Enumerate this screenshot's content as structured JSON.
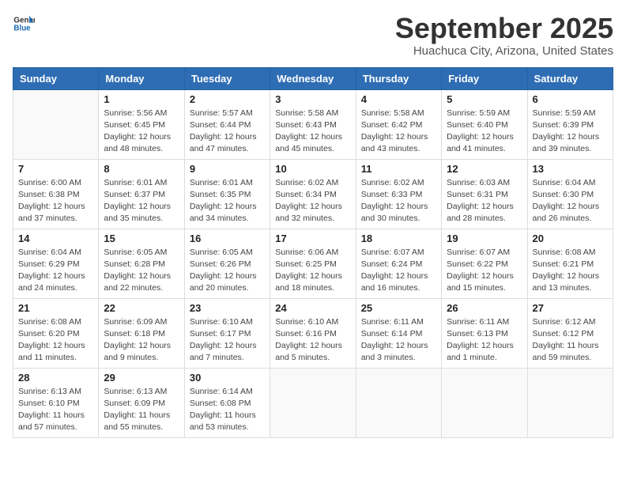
{
  "logo": {
    "line1": "General",
    "line2": "Blue"
  },
  "title": "September 2025",
  "location": "Huachuca City, Arizona, United States",
  "days_of_week": [
    "Sunday",
    "Monday",
    "Tuesday",
    "Wednesday",
    "Thursday",
    "Friday",
    "Saturday"
  ],
  "weeks": [
    [
      {
        "day": "",
        "info": ""
      },
      {
        "day": "1",
        "info": "Sunrise: 5:56 AM\nSunset: 6:45 PM\nDaylight: 12 hours\nand 48 minutes."
      },
      {
        "day": "2",
        "info": "Sunrise: 5:57 AM\nSunset: 6:44 PM\nDaylight: 12 hours\nand 47 minutes."
      },
      {
        "day": "3",
        "info": "Sunrise: 5:58 AM\nSunset: 6:43 PM\nDaylight: 12 hours\nand 45 minutes."
      },
      {
        "day": "4",
        "info": "Sunrise: 5:58 AM\nSunset: 6:42 PM\nDaylight: 12 hours\nand 43 minutes."
      },
      {
        "day": "5",
        "info": "Sunrise: 5:59 AM\nSunset: 6:40 PM\nDaylight: 12 hours\nand 41 minutes."
      },
      {
        "day": "6",
        "info": "Sunrise: 5:59 AM\nSunset: 6:39 PM\nDaylight: 12 hours\nand 39 minutes."
      }
    ],
    [
      {
        "day": "7",
        "info": "Sunrise: 6:00 AM\nSunset: 6:38 PM\nDaylight: 12 hours\nand 37 minutes."
      },
      {
        "day": "8",
        "info": "Sunrise: 6:01 AM\nSunset: 6:37 PM\nDaylight: 12 hours\nand 35 minutes."
      },
      {
        "day": "9",
        "info": "Sunrise: 6:01 AM\nSunset: 6:35 PM\nDaylight: 12 hours\nand 34 minutes."
      },
      {
        "day": "10",
        "info": "Sunrise: 6:02 AM\nSunset: 6:34 PM\nDaylight: 12 hours\nand 32 minutes."
      },
      {
        "day": "11",
        "info": "Sunrise: 6:02 AM\nSunset: 6:33 PM\nDaylight: 12 hours\nand 30 minutes."
      },
      {
        "day": "12",
        "info": "Sunrise: 6:03 AM\nSunset: 6:31 PM\nDaylight: 12 hours\nand 28 minutes."
      },
      {
        "day": "13",
        "info": "Sunrise: 6:04 AM\nSunset: 6:30 PM\nDaylight: 12 hours\nand 26 minutes."
      }
    ],
    [
      {
        "day": "14",
        "info": "Sunrise: 6:04 AM\nSunset: 6:29 PM\nDaylight: 12 hours\nand 24 minutes."
      },
      {
        "day": "15",
        "info": "Sunrise: 6:05 AM\nSunset: 6:28 PM\nDaylight: 12 hours\nand 22 minutes."
      },
      {
        "day": "16",
        "info": "Sunrise: 6:05 AM\nSunset: 6:26 PM\nDaylight: 12 hours\nand 20 minutes."
      },
      {
        "day": "17",
        "info": "Sunrise: 6:06 AM\nSunset: 6:25 PM\nDaylight: 12 hours\nand 18 minutes."
      },
      {
        "day": "18",
        "info": "Sunrise: 6:07 AM\nSunset: 6:24 PM\nDaylight: 12 hours\nand 16 minutes."
      },
      {
        "day": "19",
        "info": "Sunrise: 6:07 AM\nSunset: 6:22 PM\nDaylight: 12 hours\nand 15 minutes."
      },
      {
        "day": "20",
        "info": "Sunrise: 6:08 AM\nSunset: 6:21 PM\nDaylight: 12 hours\nand 13 minutes."
      }
    ],
    [
      {
        "day": "21",
        "info": "Sunrise: 6:08 AM\nSunset: 6:20 PM\nDaylight: 12 hours\nand 11 minutes."
      },
      {
        "day": "22",
        "info": "Sunrise: 6:09 AM\nSunset: 6:18 PM\nDaylight: 12 hours\nand 9 minutes."
      },
      {
        "day": "23",
        "info": "Sunrise: 6:10 AM\nSunset: 6:17 PM\nDaylight: 12 hours\nand 7 minutes."
      },
      {
        "day": "24",
        "info": "Sunrise: 6:10 AM\nSunset: 6:16 PM\nDaylight: 12 hours\nand 5 minutes."
      },
      {
        "day": "25",
        "info": "Sunrise: 6:11 AM\nSunset: 6:14 PM\nDaylight: 12 hours\nand 3 minutes."
      },
      {
        "day": "26",
        "info": "Sunrise: 6:11 AM\nSunset: 6:13 PM\nDaylight: 12 hours\nand 1 minute."
      },
      {
        "day": "27",
        "info": "Sunrise: 6:12 AM\nSunset: 6:12 PM\nDaylight: 11 hours\nand 59 minutes."
      }
    ],
    [
      {
        "day": "28",
        "info": "Sunrise: 6:13 AM\nSunset: 6:10 PM\nDaylight: 11 hours\nand 57 minutes."
      },
      {
        "day": "29",
        "info": "Sunrise: 6:13 AM\nSunset: 6:09 PM\nDaylight: 11 hours\nand 55 minutes."
      },
      {
        "day": "30",
        "info": "Sunrise: 6:14 AM\nSunset: 6:08 PM\nDaylight: 11 hours\nand 53 minutes."
      },
      {
        "day": "",
        "info": ""
      },
      {
        "day": "",
        "info": ""
      },
      {
        "day": "",
        "info": ""
      },
      {
        "day": "",
        "info": ""
      }
    ]
  ]
}
